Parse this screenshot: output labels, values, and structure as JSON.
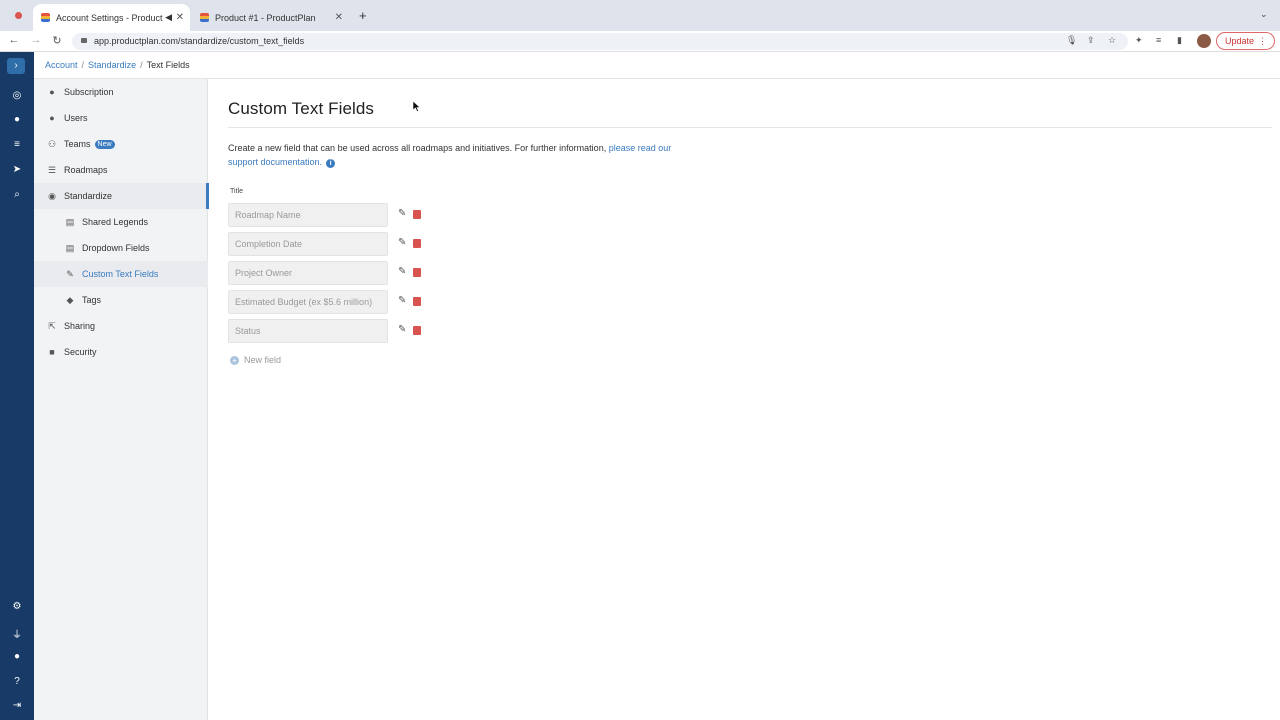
{
  "browser": {
    "tabs": [
      {
        "title": "Account Settings - Product"
      },
      {
        "title": "Product #1 - ProductPlan"
      }
    ],
    "url": "app.productplan.com/standardize/custom_text_fields",
    "update_label": "Update"
  },
  "breadcrumb": {
    "items": [
      "Account",
      "Standardize",
      "Text Fields"
    ]
  },
  "sidebar": {
    "items": [
      {
        "label": "Subscription",
        "icon": "info-icon"
      },
      {
        "label": "Users",
        "icon": "user-icon"
      },
      {
        "label": "Teams",
        "icon": "team-icon",
        "badge": "New"
      },
      {
        "label": "Roadmaps",
        "icon": "roadmap-icon"
      },
      {
        "label": "Standardize",
        "icon": "standardize-icon"
      },
      {
        "label": "Shared Legends",
        "icon": "legend-icon"
      },
      {
        "label": "Dropdown Fields",
        "icon": "dropdown-icon"
      },
      {
        "label": "Custom Text Fields",
        "icon": "edit-icon"
      },
      {
        "label": "Tags",
        "icon": "tag-icon"
      },
      {
        "label": "Sharing",
        "icon": "share-icon"
      },
      {
        "label": "Security",
        "icon": "lock-icon"
      }
    ]
  },
  "main": {
    "title": "Custom Text Fields",
    "description": "Create a new field that can be used across all roadmaps and initiatives. For further information, ",
    "link_text": "please read our support documentation.",
    "column_title": "Title",
    "fields": [
      {
        "placeholder": "Roadmap Name"
      },
      {
        "placeholder": "Completion Date"
      },
      {
        "placeholder": "Project Owner"
      },
      {
        "placeholder": "Estimated Budget (ex $5.6 million)"
      },
      {
        "placeholder": "Status"
      }
    ],
    "new_field_label": "New field"
  },
  "colors": {
    "accent": "#3b7bbf",
    "rail": "#173a66",
    "danger": "#d9534f"
  }
}
